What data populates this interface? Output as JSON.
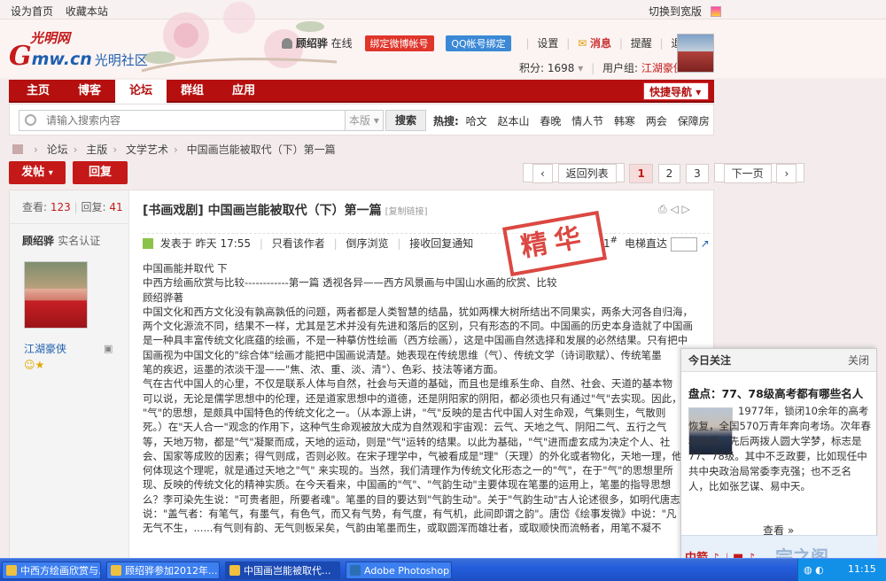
{
  "topbar": {
    "set_home": "设为首页",
    "bookmark": "收藏本站",
    "switch_wide": "切换到宽版"
  },
  "header": {
    "logo_g": "G",
    "logo_cn": "mw.cn",
    "logo_top": "光明网",
    "logo_community": "光明社区",
    "username": "顾绍骅",
    "online": "在线",
    "bind_weibo": "绑定微博帐号",
    "bind_qq": "QQ帐号绑定",
    "settings": "设置",
    "messages": "消息",
    "remind": "提醒",
    "logout": "退出",
    "points_label": "积分: 1698",
    "group_label": "用户组:",
    "group_value": "江湖豪侠"
  },
  "nav": {
    "items": [
      "主页",
      "博客",
      "论坛",
      "群组",
      "应用"
    ],
    "active": 2,
    "quick": "快捷导航"
  },
  "search": {
    "placeholder": "请输入搜索内容",
    "scope": "本版",
    "button": "搜索",
    "hot_label": "热搜:",
    "hot": [
      "哈文",
      "赵本山",
      "春晚",
      "情人节",
      "韩寒",
      "两会",
      "保障房"
    ]
  },
  "breadcrumb": [
    "论坛",
    "主版",
    "文学艺术",
    "中国画岂能被取代（下）第一篇"
  ],
  "actions": {
    "post": "发帖",
    "reply": "回复"
  },
  "pager": {
    "back": "返回列表",
    "pages": [
      "1",
      "2",
      "3"
    ],
    "current": "1",
    "next": "下一页"
  },
  "post": {
    "views_label": "查看:",
    "views": "123",
    "replies_label": "回复:",
    "replies": "41",
    "author": "顾绍骅",
    "verified": "实名认证",
    "nickname": "江湖豪侠",
    "title": "[书画戏剧] 中国画岂能被取代（下）第一篇",
    "copy_link": "[复制链接]",
    "posted": "发表于 昨天 17:55",
    "only_author": "只看该作者",
    "reverse": "倒序浏览",
    "notify": "接收回复通知",
    "floor": "1",
    "elevator": "电梯直达",
    "stamp": "精华",
    "body": [
      "中国画能并取代    下",
      "中西方绘画欣赏与比较------------第一篇  透视各异——西方风景画与中国山水画的欣赏、比较",
      "顾绍骅著",
      "中国文化和西方文化没有孰高孰低的问题，两者都是人类智慧的结晶，犹如两棵大树所结出不同果实，两条大河各自归海，",
      "两个文化源流不同，结果不一样，尤其是艺术并没有先进和落后的区别，只有形态的不同。中国画的历史本身造就了中国画",
      "是一种具丰富传统文化底蕴的绘画，不是一种摹仿性绘画（西方绘画），这是中国画自然选择和发展的必然结果。只有把中",
      "国画视为中国文化的\"综合体\"绘画才能把中国画说清楚。她表现在传统思维（气）、传统文学（诗词歌赋）、传统笔墨",
      "笔的疾迟，运墨的浓淡干湿——\"焦、浓、重、淡、清\"）、色彩、技法等诸方面。",
      "气在古代中国人的心里，不仅是联系人体与自然，社会与天道的基础，而且也是维系生命、自然、社会、天道的基本物",
      "可以说，无论是儒学思想中的伦理，还是道家思想中的道德，还是阴阳家的阴阳，都必须也只有通过\"气\"去实现。因此，",
      "\"气\"的思想，是颇具中国特色的传统文化之一。（从本源上讲，\"气\"反映的是古代中国人对生命观，气集则生，气散则",
      "死。）在\"天人合一\"观念的作用下，这种气生命观被放大成为自然观和宇宙观：云气、天地之气、阴阳二气、五行之气",
      "等，天地万物，都是\"气\"凝聚而成，天地的运动，则是\"气\"运转的结果。以此为基础，\"气\"进而虚玄成为决定个人、社",
      "会、国家等成败的因素；得气则成，否则必败。在宋子理学中，气被看成是\"理\"（天理）的外化或者物化，天地一理，他",
      "何体现这个理呢，就是通过天地之\"气\" 来实现的。当然，我们清理作为传统文化形态之一的\"气\"，在于\"气\"的思想里所",
      "现、反映的传统文化的精神实质。在今天看来，中国画的\"气\"、\"气韵生动\"主要体现在笔墨的运用上，笔墨的指导思想",
      "么？李可染先生说：\"可贵者胆，所要者魂\"。笔墨的目的要达到\"气韵生动\"。关于\"气韵生动\"古人论述很多，如明代唐志",
      "说：\"盖气者：有笔气，有墨气，有色气，而又有气势，有气度，有气机，此间即谓之韵\"。唐岱《绘事发微》中说：\"凡",
      "无气不生，......有气则有韵、无气则板呆矣，气韵由笔墨而生，或取圆浑而雄壮者，或取顺快而流畅者，用笔不凝不"
    ]
  },
  "popup": {
    "header": "今日关注",
    "close": "关闭",
    "title": "盘点：77、78级高考都有哪些名人",
    "text": "1977年，锁闭10余年的高考恢复，全国570万青年奔向考场。次年春秋两季，先后两拨人圆大学梦，标志是77、78级。其中不乏政要，比如现任中共中央政治局常委李克强；也不乏名人，比如张艺谋、易中天。",
    "more": "查看 »",
    "footer_logo": "中箭 ♪ ♩ ■ ♪",
    "watermark": "完之阁"
  },
  "taskbar": {
    "items": [
      "中西方绘画欣赏与...",
      "顾绍骅参加2012年...",
      "中国画岂能被取代...",
      "Adobe Photoshop"
    ],
    "active": 2,
    "clock": "11:15"
  }
}
